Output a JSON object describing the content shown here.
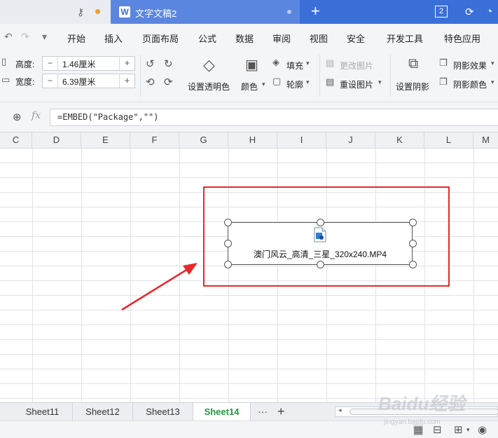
{
  "tabbar": {
    "doc_logo": "W",
    "doc_title": "文字文稿2",
    "add_label": "+",
    "window_count": "2"
  },
  "quick_access": {
    "undo": "↶",
    "redo": "↷",
    "dropdown": "▾"
  },
  "menu": {
    "items": [
      "开始",
      "插入",
      "页面布局",
      "公式",
      "数据",
      "审阅",
      "视图",
      "安全",
      "开发工具",
      "特色应用"
    ]
  },
  "ribbon": {
    "height_label": "高度:",
    "height_value": "1.46厘米",
    "width_label": "宽度:",
    "width_value": "6.39厘米",
    "minus": "−",
    "plus": "+",
    "transparent_label": "设置透明色",
    "color_label": "颜色",
    "fill_label": "填充",
    "outline_label": "轮廓",
    "change_picture_label": "更改图片",
    "reset_picture_label": "重设图片",
    "shadow_settings_label": "设置阴影",
    "shadow_effect_label": "阴影效果",
    "shadow_color_label": "阴影颜色"
  },
  "formula_bar": {
    "fx": "fx",
    "formula": "=EMBED(\"Package\",\"\")"
  },
  "columns": [
    "C",
    "D",
    "E",
    "F",
    "G",
    "H",
    "I",
    "J",
    "K",
    "L",
    "M"
  ],
  "embedded_object": {
    "filename": "澳门风云_高清_三星_320x240.MP4"
  },
  "sheets": {
    "tabs": [
      "Sheet11",
      "Sheet12",
      "Sheet13",
      "Sheet14"
    ],
    "active": "Sheet14",
    "more": "···",
    "add": "+"
  },
  "watermark": {
    "main": "Baidu经验",
    "sub": "jingyan.baidu.com"
  },
  "colors": {
    "accent_blue": "#3a6fd8",
    "highlight_red": "#e8272b",
    "active_sheet_green": "#1f9a3c"
  }
}
